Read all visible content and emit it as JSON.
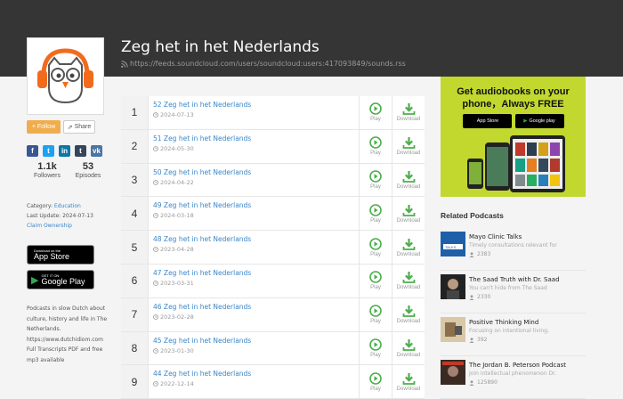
{
  "header": {
    "title": "Zeg het in het Nederlands",
    "feed_url": "https://feeds.soundcloud.com/users/soundcloud:users:417093849/sounds.rss"
  },
  "sidebar": {
    "follow_label": "+ Follow",
    "share_label": "Share",
    "followers_count": "1.1k",
    "followers_label": "Followers",
    "episodes_count": "53",
    "episodes_label": "Episodes",
    "category_label": "Category:",
    "category_value": "Education",
    "last_update": "Last Update: 2024-07-13",
    "claim_label": "Claim Ownership",
    "appstore_small": "Download on the",
    "appstore_large": "App Store",
    "googleplay_small": "GET IT ON",
    "googleplay_large": "Google Play",
    "description": "Podcasts in slow Dutch about culture, history and life in The Netherlands. https://www.dutchidiom.com Full Transcripts PDF and free mp3 available"
  },
  "episodes": [
    {
      "num": "1",
      "title": "52 Zeg het in het Nederlands",
      "date": "2024-07-13"
    },
    {
      "num": "2",
      "title": "51 Zeg het in het Nederlands",
      "date": "2024-05-30"
    },
    {
      "num": "3",
      "title": "50 Zeg het in het Nederlands",
      "date": "2024-04-22"
    },
    {
      "num": "4",
      "title": "49 Zeg het in het Nederlands",
      "date": "2024-03-18"
    },
    {
      "num": "5",
      "title": "48 Zeg het in het Nederlands",
      "date": "2023-04-28"
    },
    {
      "num": "6",
      "title": "47 Zeg het in het Nederlands",
      "date": "2023-03-31"
    },
    {
      "num": "7",
      "title": "46 Zeg het in het Nederlands",
      "date": "2023-02-28"
    },
    {
      "num": "8",
      "title": "45 Zeg het in het Nederlands",
      "date": "2023-01-30"
    },
    {
      "num": "9",
      "title": "44 Zeg het in het Nederlands",
      "date": "2022-12-14"
    }
  ],
  "actions": {
    "play": "Play",
    "download": "Download"
  },
  "ad": {
    "line1": "Get audiobooks on your",
    "line2": "phone，Always FREE",
    "appstore_small": "Download on the",
    "appstore_large": "App Store",
    "googleplay_small": "GET IT ON",
    "googleplay_large": "Google play"
  },
  "related": {
    "heading": "Related Podcasts",
    "items": [
      {
        "title": "Mayo Clinic Talks",
        "sub": "Timely consultations relevant for",
        "count": "2383"
      },
      {
        "title": "The Saad Truth with Dr. Saad",
        "sub": "You can't hide from The Saad",
        "count": "2330"
      },
      {
        "title": "Positive Thinking Mind",
        "sub": "Focusing on intentional living,",
        "count": "392"
      },
      {
        "title": "The Jordan B. Peterson Podcast",
        "sub": "Join intellectual phenomenon Dr.",
        "count": "125890"
      }
    ]
  },
  "colors": {
    "accent": "#3a86c8",
    "play_green": "#4cae4c",
    "follow": "#f0ad4e",
    "header_bg": "#353535",
    "ad_bg": "#c2d82e"
  }
}
